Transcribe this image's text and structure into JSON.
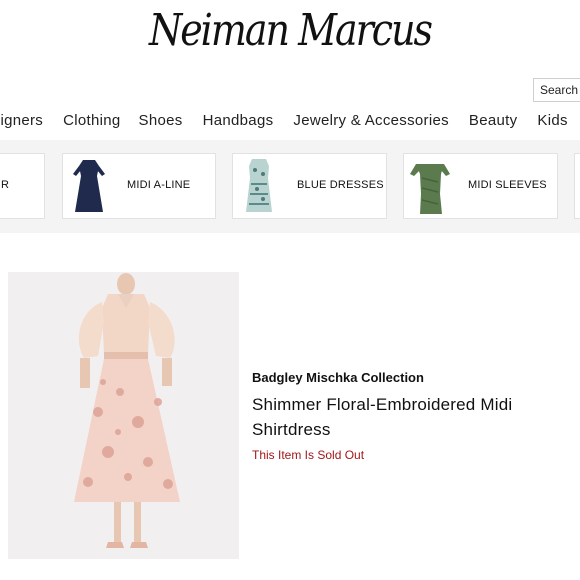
{
  "header": {
    "logo_text": "Neiman Marcus",
    "search_label": "Search"
  },
  "nav": {
    "items": [
      "esigners",
      "Clothing",
      "Shoes",
      "Handbags",
      "Jewelry & Accessories",
      "Beauty",
      "Kids"
    ]
  },
  "category_rail": {
    "tiles": [
      {
        "label": "R",
        "icon": "dress-thumbnail"
      },
      {
        "label": "MIDI A-LINE",
        "icon": "navy-dress-thumbnail"
      },
      {
        "label": "BLUE DRESSES",
        "icon": "blue-print-dress-thumbnail"
      },
      {
        "label": "MIDI SLEEVES",
        "icon": "green-dress-thumbnail"
      }
    ]
  },
  "product": {
    "brand": "Badgley Mischka Collection",
    "name": "Shimmer Floral-Embroidered Midi Shirtdress",
    "status": "This Item Is Sold Out",
    "image": "pink-floral-midi-shirtdress-photo",
    "status_color": "#a01818"
  }
}
